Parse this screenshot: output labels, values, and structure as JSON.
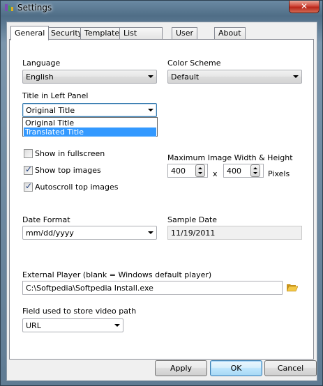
{
  "window": {
    "title": "Settings",
    "close_label": "✕"
  },
  "tabs": [
    {
      "label": "General",
      "active": true
    },
    {
      "label": "Security"
    },
    {
      "label": "Template"
    },
    {
      "label": "List Template"
    },
    {
      "label": "User Vars"
    },
    {
      "label": "About"
    }
  ],
  "general": {
    "language": {
      "label": "Language",
      "value": "English"
    },
    "color_scheme": {
      "label": "Color Scheme",
      "value": "Default"
    },
    "title_left_panel": {
      "label": "Title in Left Panel",
      "value": "Original Title",
      "options": [
        "Original Title",
        "Translated Title"
      ],
      "highlighted_option": "Translated Title"
    },
    "show_fullscreen": {
      "label": "Show in fullscreen",
      "checked": false
    },
    "show_top_images": {
      "label": "Show top images",
      "checked": true
    },
    "autoscroll_top_images": {
      "label": "Autoscroll top images",
      "checked": true
    },
    "max_image": {
      "label": "Maximum Image Width & Height",
      "width": "400",
      "height": "400",
      "separator": "x",
      "unit": "Pixels"
    },
    "date_format": {
      "label": "Date Format",
      "value": "mm/dd/yyyy"
    },
    "sample_date": {
      "label": "Sample Date",
      "value": "11/19/2011"
    },
    "external_player": {
      "label": "External Player (blank = Windows default player)",
      "value": "C:\\Softpedia\\Softpedia Install.exe"
    },
    "video_path_field": {
      "label": "Field used to store video path",
      "value": "URL"
    }
  },
  "buttons": {
    "apply": "Apply",
    "ok": "OK",
    "cancel": "Cancel"
  }
}
